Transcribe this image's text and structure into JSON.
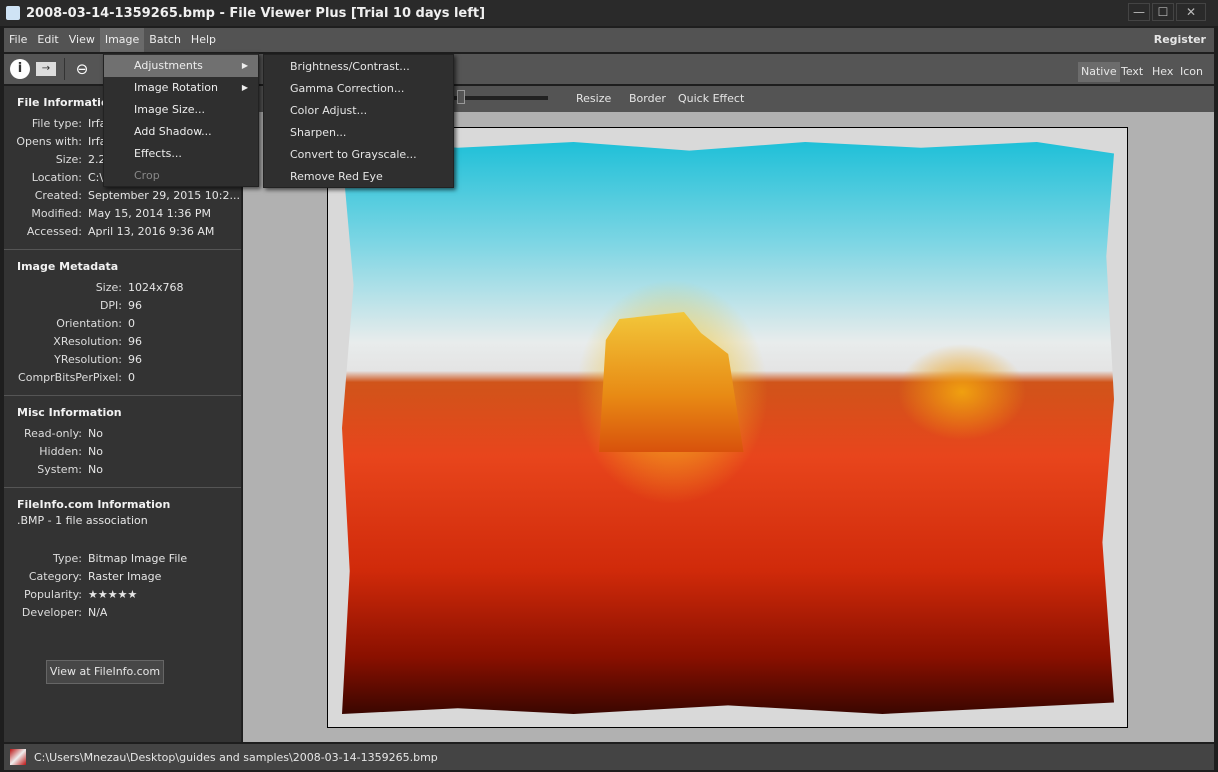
{
  "window": {
    "title": "2008-03-14-1359265.bmp - File Viewer Plus [Trial 10 days left]",
    "minimize": "—",
    "maximize": "☐",
    "close": "✕"
  },
  "menu": {
    "items": [
      "File",
      "Edit",
      "View",
      "Image",
      "Batch",
      "Help"
    ],
    "register": "Register"
  },
  "view_tabs": {
    "items": [
      "Native",
      "Text",
      "Hex",
      "Icon"
    ],
    "selected": "Native"
  },
  "viewer_toolbar": {
    "resize": "Resize",
    "border": "Border",
    "quick_effect": "Quick Effect"
  },
  "image_menu": {
    "items": [
      {
        "label": "Adjustments",
        "submenu": true
      },
      {
        "label": "Image Rotation",
        "submenu": true
      },
      {
        "label": "Image Size..."
      },
      {
        "label": "Add Shadow..."
      },
      {
        "label": "Effects..."
      },
      {
        "label": "Crop",
        "disabled": true
      }
    ],
    "arrow": "▶",
    "adjustments": [
      "Brightness/Contrast...",
      "Gamma Correction...",
      "Color Adjust...",
      "Sharpen...",
      "Convert to Grayscale...",
      "Remove Red Eye"
    ]
  },
  "file_info": {
    "title": "File Information",
    "rows": [
      {
        "k": "File type:",
        "v": "Irfa"
      },
      {
        "k": "Opens with:",
        "v": "Irfa"
      },
      {
        "k": "Size:",
        "v": "2.2"
      },
      {
        "k": "Location:",
        "v": "C:\\"
      },
      {
        "k": "Created:",
        "v": "September 29, 2015 10:2..."
      },
      {
        "k": "Modified:",
        "v": "May 15, 2014 1:36 PM"
      },
      {
        "k": "Accessed:",
        "v": "April 13, 2016 9:36 AM"
      }
    ]
  },
  "image_metadata": {
    "title": "Image Metadata",
    "rows": [
      {
        "k": "Size:",
        "v": "1024x768"
      },
      {
        "k": "DPI:",
        "v": "96"
      },
      {
        "k": "Orientation:",
        "v": "0"
      },
      {
        "k": "XResolution:",
        "v": "96"
      },
      {
        "k": "YResolution:",
        "v": "96"
      },
      {
        "k": "ComprBitsPerPixel:",
        "v": "0"
      }
    ]
  },
  "misc_info": {
    "title": "Misc Information",
    "rows": [
      {
        "k": "Read-only:",
        "v": "No"
      },
      {
        "k": "Hidden:",
        "v": "No"
      },
      {
        "k": "System:",
        "v": "No"
      }
    ]
  },
  "fileinfo_com": {
    "title": "FileInfo.com Information",
    "association": ".BMP - 1 file association",
    "rows": [
      {
        "k": "Type:",
        "v": "Bitmap Image File"
      },
      {
        "k": "Category:",
        "v": "Raster Image"
      },
      {
        "k": "Popularity:",
        "v": "★★★★★"
      },
      {
        "k": "Developer:",
        "v": "N/A"
      }
    ],
    "button": "View at FileInfo.com",
    "popularity_stars": 5
  },
  "status": {
    "path": "C:\\Users\\Mnezau\\Desktop\\guides and samples\\2008-03-14-1359265.bmp"
  }
}
